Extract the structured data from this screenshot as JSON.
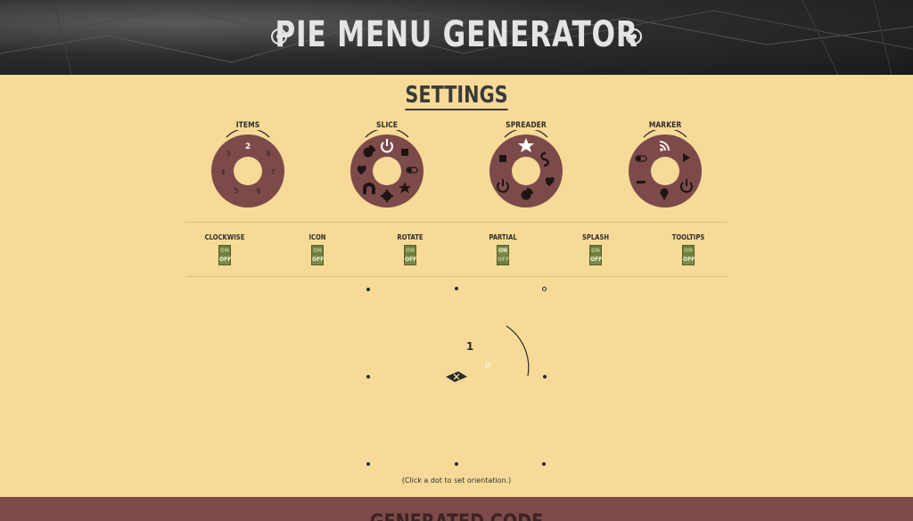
{
  "header": {
    "title": "PIE MENU GENERATOR"
  },
  "settings": {
    "title": "SETTINGS"
  },
  "wheels": [
    {
      "label": "ITEMS",
      "type": "numbers",
      "selected": "2",
      "numbers": [
        "2",
        "8",
        "7",
        "6",
        "5",
        "4",
        "3"
      ]
    },
    {
      "label": "SLICE",
      "type": "icons",
      "selected": "power-icon",
      "icons": [
        "power-icon",
        "square-icon",
        "toggle-icon",
        "star-icon",
        "gear-icon",
        "magnet-icon",
        "heart-icon",
        "pie-chart-icon"
      ]
    },
    {
      "label": "SPREADER",
      "type": "icons",
      "selected": "star-icon",
      "icons": [
        "star-icon",
        "dollar-icon",
        "heart-icon",
        "pie-chart-icon",
        "power-icon",
        "square-icon"
      ]
    },
    {
      "label": "MARKER",
      "type": "icons",
      "selected": "rss-icon",
      "icons": [
        "rss-icon",
        "play-icon",
        "power-icon",
        "map-pin-icon",
        "minus-icon",
        "toggle-icon"
      ]
    }
  ],
  "toggles": [
    {
      "label": "CLOCKWISE",
      "on": "ON",
      "off": "OFF",
      "state": "off"
    },
    {
      "label": "ICON",
      "on": "ON",
      "off": "OFF",
      "state": "off"
    },
    {
      "label": "ROTATE",
      "on": "ON",
      "off": "OFF",
      "state": "off"
    },
    {
      "label": "PARTIAL",
      "on": "ON",
      "off": "OFF",
      "state": "on"
    },
    {
      "label": "SPLASH",
      "on": "ON",
      "off": "OFF",
      "state": "off"
    },
    {
      "label": "TOOLTIPS",
      "on": "ON",
      "off": "OFF",
      "state": "off"
    }
  ],
  "orientation": {
    "hint": "(Click a dot to set orientation.)",
    "preview_labels": [
      "1",
      "0"
    ],
    "selected_dot": "top-right"
  },
  "footer": {
    "title": "GENERATED CODE"
  },
  "colors": {
    "background": "#f7da97",
    "wheel": "#7d4a4a",
    "toggle": "#6f7f3c",
    "header": "#2c2c2c"
  }
}
